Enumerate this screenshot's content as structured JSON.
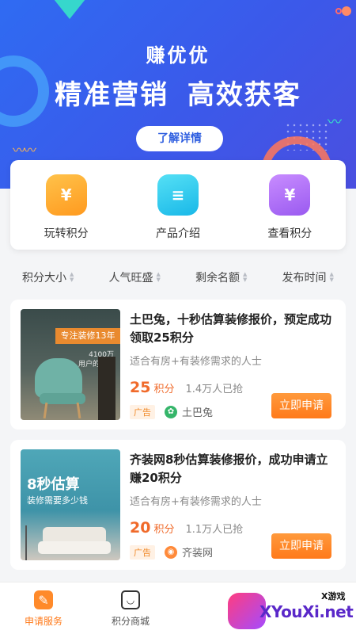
{
  "banner": {
    "brand": "赚优优",
    "slogan": "精准营销 高效获客",
    "button_label": "了解详情"
  },
  "quick_actions": [
    {
      "label": "玩转积分",
      "icon": "money-bag-icon",
      "icon_glyph": "¥",
      "color": "#ffb02e"
    },
    {
      "label": "产品介绍",
      "icon": "document-icon",
      "icon_glyph": "≡",
      "color": "#24c4ec"
    },
    {
      "label": "查看积分",
      "icon": "yen-coin-icon",
      "icon_glyph": "¥",
      "color": "#b070f8"
    }
  ],
  "sort_options": [
    "积分大小",
    "人气旺盛",
    "剩余名额",
    "发布时间"
  ],
  "offers": [
    {
      "image_tag": "专注装修13年",
      "image_subtitle": "4100万\n用户的选择",
      "title": "土巴兔，十秒估算装修报价，预定成功领取25积分",
      "description": "适合有房+有装修需求的人士",
      "points": "25",
      "points_unit": "积分",
      "grabbed": "1.4万人已抢",
      "ad_label": "广告",
      "brand": "土巴兔",
      "button": "立即申请"
    },
    {
      "image_title": "8秒估算",
      "image_subtitle": "装修需要多少钱",
      "title": "齐装网8秒估算装修报价，成功申请立赚20积分",
      "description": "适合有房+有装修需求的人士",
      "points": "20",
      "points_unit": "积分",
      "grabbed": "1.1万人已抢",
      "ad_label": "广告",
      "brand": "齐装网",
      "button": "立即申请"
    }
  ],
  "bottom_nav": [
    {
      "label": "申请服务",
      "icon": "apply-service-icon",
      "active": true
    },
    {
      "label": "积分商城",
      "icon": "shopping-bag-icon",
      "active": false
    }
  ],
  "watermark": {
    "cn": "X游戏",
    "text": "XYouXi.net"
  },
  "colors": {
    "primary": "#2f6bf2",
    "accent": "#ff7a1a"
  }
}
